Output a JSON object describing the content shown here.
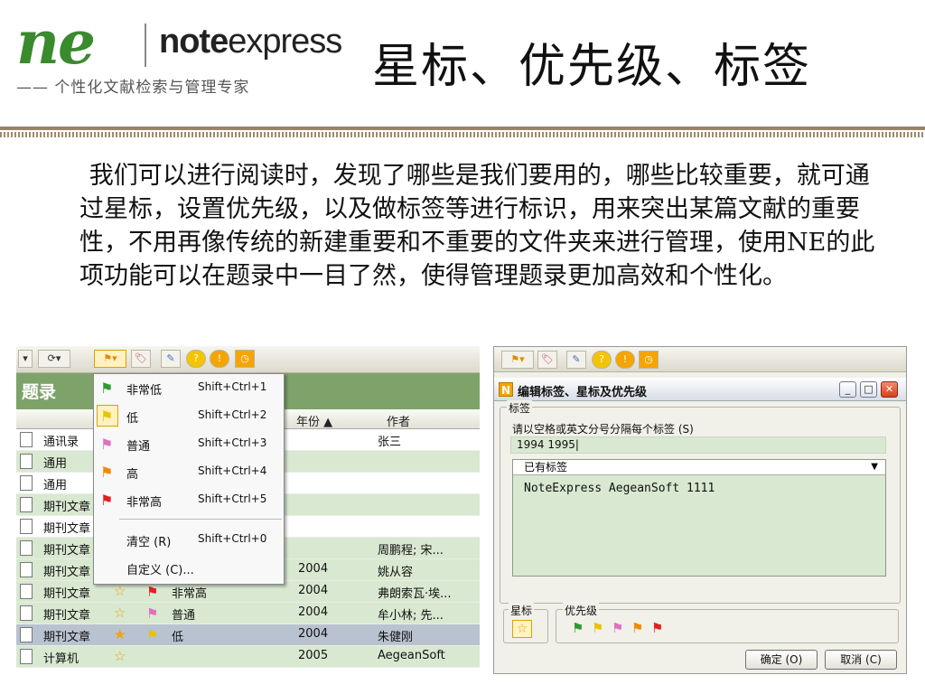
{
  "header": {
    "logo_ne": "ne",
    "logo_note": "note",
    "logo_express": "express",
    "slogan": "—— 个性化文献检索与管理专家",
    "title": "星标、优先级、标签"
  },
  "intro": "我们可以进行阅读时，发现了哪些是我们要用的，哪些比较重要，就可通过星标，设置优先级，以及做标签等进行标识，用来突出某篇文献的重要性，不用再像传统的新建重要和不重要的文件夹来进行管理，使用NE的此项功能可以在题录中一目了然，使得管理题录更加高效和个性化。",
  "left_screenshot": {
    "pane_title": "题录",
    "columns": {
      "year": "年份 ▲",
      "author": "作者"
    },
    "rows": [
      {
        "type": "通讯录",
        "star": "",
        "flag": "",
        "priority": "",
        "year": "",
        "author": "张三"
      },
      {
        "type": "通用",
        "star": "",
        "flag": "",
        "priority": "",
        "year": "",
        "author": ""
      },
      {
        "type": "通用",
        "star": "",
        "flag": "",
        "priority": "",
        "year": "",
        "author": ""
      },
      {
        "type": "期刊文章",
        "star": "",
        "flag": "",
        "priority": "",
        "year": "",
        "author": ""
      },
      {
        "type": "期刊文章",
        "star": "",
        "flag": "",
        "priority": "",
        "year": "",
        "author": ""
      },
      {
        "type": "期刊文章",
        "star": "",
        "flag": "",
        "priority": "",
        "year": "",
        "author": "周鹏程; 宋..."
      },
      {
        "type": "期刊文章",
        "star": "",
        "flag": "",
        "priority": "",
        "year": "2004",
        "author": "姚从容"
      },
      {
        "type": "期刊文章",
        "star": "☆",
        "flag": "⚑",
        "priority": "非常高",
        "year": "2004",
        "author": "弗朗索瓦·埃..."
      },
      {
        "type": "期刊文章",
        "star": "☆",
        "flag": "⚑",
        "priority": "普通",
        "year": "2004",
        "author": "牟小林; 先..."
      },
      {
        "type": "期刊文章",
        "star": "★",
        "flag": "⚑",
        "priority": "低",
        "year": "2004",
        "author": "朱健刚"
      },
      {
        "type": "计算机",
        "star": "☆",
        "flag": "",
        "priority": "",
        "year": "2005",
        "author": "AegeanSoft"
      }
    ],
    "menu": [
      {
        "label": "非常低",
        "shortcut": "Shift+Ctrl+1",
        "flag": "⚑",
        "color": "#2e9b2e"
      },
      {
        "label": "低",
        "shortcut": "Shift+Ctrl+2",
        "flag": "⚑",
        "color": "#e8c400"
      },
      {
        "label": "普通",
        "shortcut": "Shift+Ctrl+3",
        "flag": "⚑",
        "color": "#e070c0"
      },
      {
        "label": "高",
        "shortcut": "Shift+Ctrl+4",
        "flag": "⚑",
        "color": "#f08a00"
      },
      {
        "label": "非常高",
        "shortcut": "Shift+Ctrl+5",
        "flag": "⚑",
        "color": "#e02020"
      },
      {
        "label": "清空 (R)",
        "shortcut": "Shift+Ctrl+0"
      },
      {
        "label": "自定义 (C)..."
      }
    ]
  },
  "dialog": {
    "title": "编辑标签、星标及优先级",
    "tag_legend": "标签",
    "tag_hint": "请以空格或英文分号分隔每个标签 (S)",
    "tag_input": "1994 1995|",
    "existing_label": "已有标签",
    "existing_tags": "NoteExpress  AegeanSoft  1111",
    "star_legend": "星标",
    "priority_legend": "优先级",
    "ok": "确定 (O)",
    "cancel": "取消 (C)",
    "priority_colors": [
      "#2e9b2e",
      "#e8c400",
      "#e070c0",
      "#f08a00",
      "#e02020"
    ]
  },
  "colors": {
    "pane_green": "#7ea36a",
    "row_green": "#d9e8d1",
    "row_selected": "#b9c2d0",
    "star_orange": "#f2a400"
  }
}
